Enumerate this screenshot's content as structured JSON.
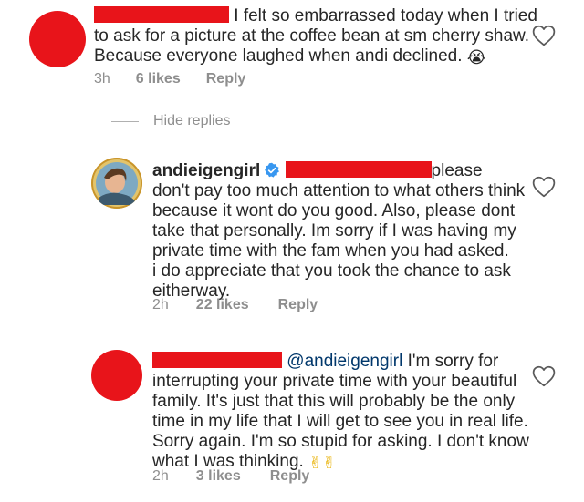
{
  "comments": [
    {
      "text_line1": " I felt so embarrassed today when I tried",
      "text_rest": "to ask for a picture at the coffee bean at sm cherry shaw.\nBecause everyone laughed when andi declined. ",
      "emoji": "😭",
      "time": "3h",
      "likes": "6 likes",
      "reply": "Reply"
    },
    {
      "username": "andieigengirl",
      "text_line1": "please",
      "text_rest": "don't pay too much attention to what others think\nbecause it wont do you good. Also, please dont\ntake that personally. Im sorry if I was having my\nprivate time with the fam when you had asked.\ni do appreciate that you took the chance to ask\neitherway.",
      "time": "2h",
      "likes": "22 likes",
      "reply": "Reply"
    },
    {
      "mention": "@andieigengirl",
      "text_line1": " I'm sorry for",
      "text_rest": "interrupting your private time with your beautiful\nfamily. It's just that this will probably be the only\ntime in my life that I will get to see you in real life.\nSorry again. I'm so stupid for asking. I don't know\nwhat I was thinking. ",
      "emoji": "✌✌",
      "time": "2h",
      "likes": "3 likes",
      "reply": "Reply"
    }
  ],
  "hide_replies": "Hide replies",
  "icons": {
    "heart": "heart-outline-icon",
    "verified": "verified-badge-icon"
  },
  "colors": {
    "redaction": "#e8141a",
    "verified": "#3897f0",
    "meta_gray": "#8e8e8e"
  }
}
